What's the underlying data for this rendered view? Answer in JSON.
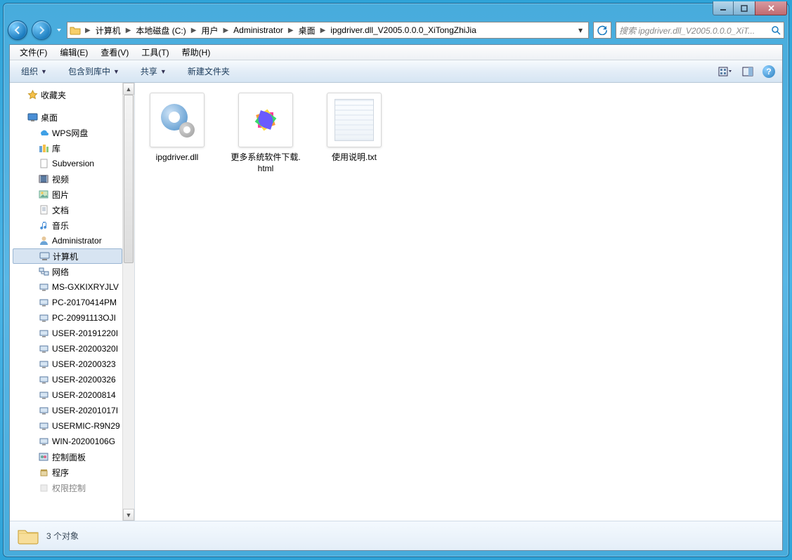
{
  "window": {
    "min_tooltip": "最小化",
    "max_tooltip": "最大化",
    "close_tooltip": "关闭"
  },
  "nav": {
    "back_tooltip": "后退",
    "forward_tooltip": "前进"
  },
  "breadcrumbs": [
    "计算机",
    "本地磁盘 (C:)",
    "用户",
    "Administrator",
    "桌面",
    "ipgdriver.dll_V2005.0.0.0_XiTongZhiJia"
  ],
  "search_placeholder": "搜索 ipgdriver.dll_V2005.0.0.0_XiT...",
  "menu": {
    "file": "文件(F)",
    "edit": "编辑(E)",
    "view": "查看(V)",
    "tools": "工具(T)",
    "help": "帮助(H)"
  },
  "toolbar": {
    "organize": "组织",
    "include": "包含到库中",
    "share": "共享",
    "newfolder": "新建文件夹"
  },
  "sidebar": {
    "favorites": "收藏夹",
    "desktop": "桌面",
    "wps": "WPS网盘",
    "libraries": "库",
    "lib_items": [
      "Subversion",
      "视频",
      "图片",
      "文档",
      "音乐"
    ],
    "admin": "Administrator",
    "computer": "计算机",
    "network": "网络",
    "net_items": [
      "MS-GXKIXRYJLV",
      "PC-20170414PM",
      "PC-20991113OJI",
      "USER-20191220I",
      "USER-20200320I",
      "USER-20200323",
      "USER-20200326",
      "USER-20200814",
      "USER-20201017I",
      "USERMIC-R9N29",
      "WIN-20200106G"
    ],
    "control_panel": "控制面板",
    "programs": "程序",
    "clipped": "权限控制"
  },
  "files": [
    {
      "name": "ipgdriver.dll",
      "icon": "dll"
    },
    {
      "name": "更多系统软件下载.html",
      "icon": "html"
    },
    {
      "name": "使用说明.txt",
      "icon": "txt"
    }
  ],
  "status": {
    "text": "3 个对象"
  }
}
